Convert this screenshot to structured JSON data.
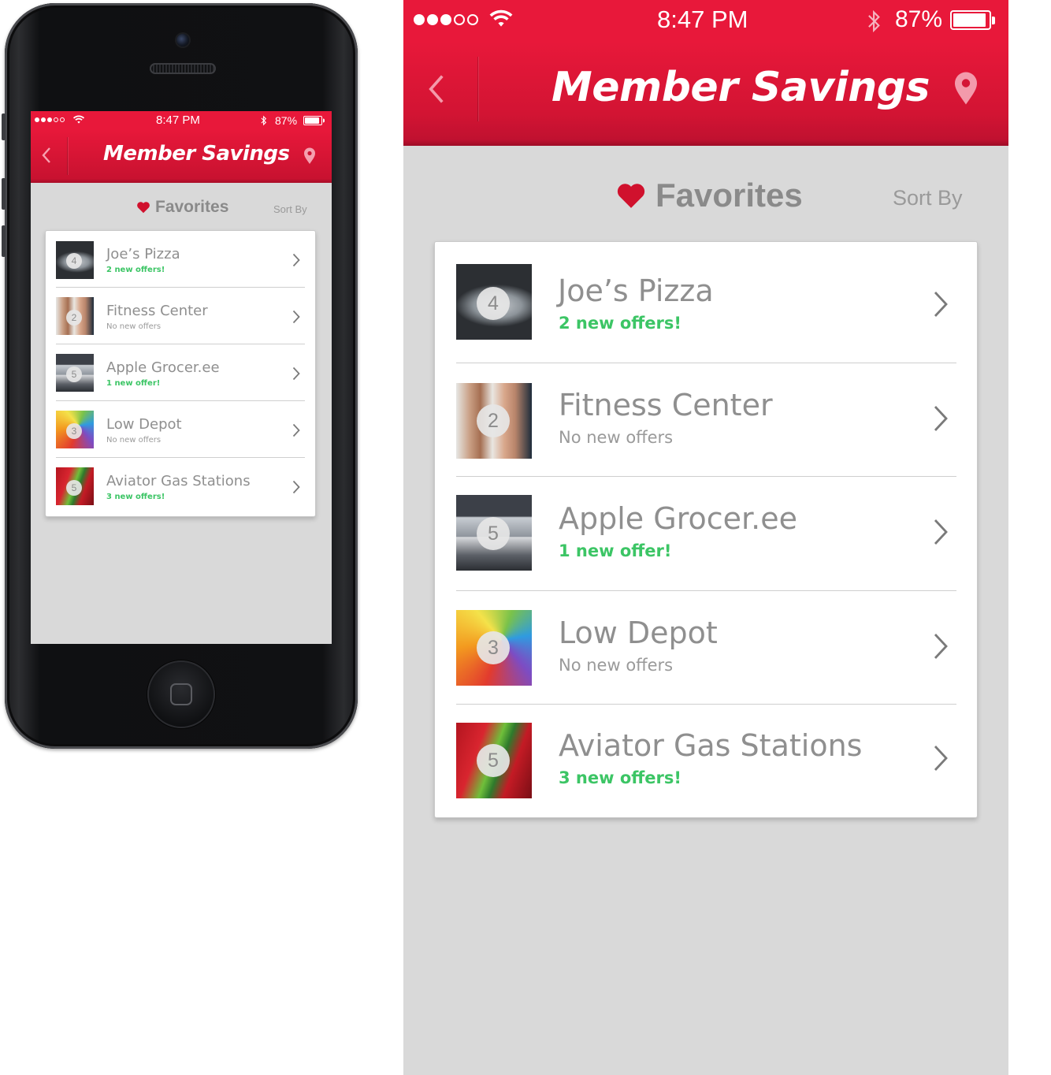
{
  "status": {
    "time": "8:47 PM",
    "battery": "87%",
    "battery_level": 0.87,
    "signal_bars_filled": 3,
    "signal_bars_total": 5
  },
  "header": {
    "title": "Member Savings",
    "back_icon": "chevron-left-icon",
    "location_icon": "map-pin-icon"
  },
  "favorites": {
    "label": "Favorites",
    "icon": "heart-icon",
    "sort_label": "Sort By"
  },
  "items": [
    {
      "name": "Joe’s Pizza",
      "count": "4",
      "offers": "2 new offers!",
      "has_new": true
    },
    {
      "name": "Fitness Center",
      "count": "2",
      "offers": "No new offers",
      "has_new": false
    },
    {
      "name": "Apple Grocer.ee",
      "count": "5",
      "offers": "1 new offer!",
      "has_new": true
    },
    {
      "name": "Low Depot",
      "count": "3",
      "offers": "No new offers",
      "has_new": false
    },
    {
      "name": "Aviator Gas Stations",
      "count": "5",
      "offers": "3 new offers!",
      "has_new": true
    }
  ],
  "colors": {
    "brand_red": "#e8183a",
    "offer_green": "#3cc565",
    "background": "#d9d9d9"
  }
}
